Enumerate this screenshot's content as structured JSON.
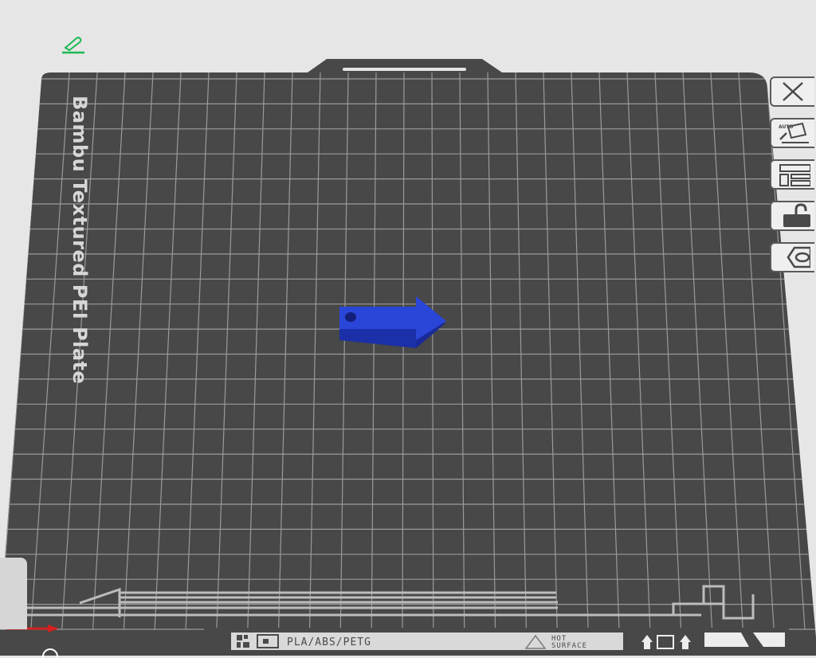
{
  "plate": {
    "name": "Bambu Textured PEI Plate",
    "material_label": "PLA/ABS/PETG",
    "hot_surface_line1": "HOT",
    "hot_surface_line2": "SURFACE"
  },
  "model": {
    "name": "arrow",
    "color": "#2a46d8"
  },
  "toolbar": {
    "items": [
      {
        "name": "close",
        "icon": "close-icon"
      },
      {
        "name": "auto-orient",
        "icon": "auto-orient-icon",
        "badge": "AUTO"
      },
      {
        "name": "arrange",
        "icon": "arrange-icon"
      },
      {
        "name": "lock",
        "icon": "lock-icon"
      },
      {
        "name": "settings",
        "icon": "hex-nut-icon"
      }
    ]
  },
  "colors": {
    "background": "#e6e6e6",
    "plate": "#474847",
    "grid": "#9a9a9a",
    "edit_icon": "#1db954",
    "x_axis": "#d42020"
  }
}
